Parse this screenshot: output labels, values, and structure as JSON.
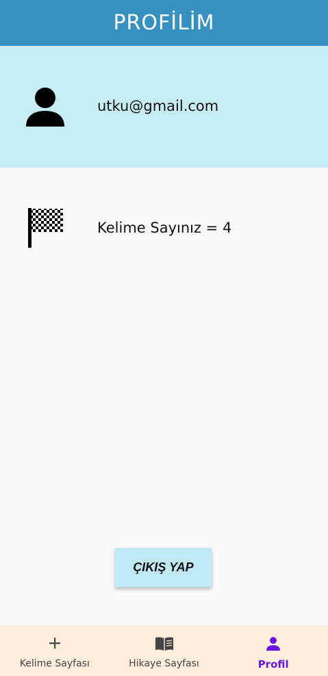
{
  "header": {
    "title": "PROFİLİM"
  },
  "profile": {
    "email": "utku@gmail.com",
    "word_count_text": "Kelime Sayınız = 4"
  },
  "actions": {
    "logout_label": "ÇIKIŞ YAP"
  },
  "bottom_nav": {
    "items": [
      {
        "label": "Kelime Sayfası",
        "icon": "plus-icon"
      },
      {
        "label": "Hikaye Sayfası",
        "icon": "book-icon"
      },
      {
        "label": "Profil",
        "icon": "person-icon",
        "active": true
      }
    ]
  },
  "colors": {
    "header_bg": "#3691c0",
    "card_bg": "#c7edf7",
    "button_bg": "#bfe9f4",
    "nav_bg": "#fdeedd",
    "active_accent": "#6b16e0"
  }
}
